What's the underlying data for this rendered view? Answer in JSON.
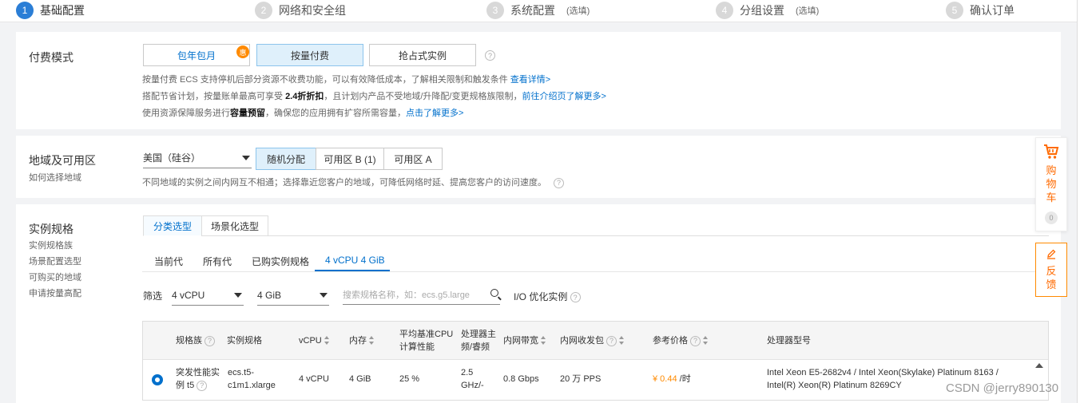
{
  "steps": [
    {
      "num": "1",
      "label": "基础配置",
      "optional": ""
    },
    {
      "num": "2",
      "label": "网络和安全组",
      "optional": ""
    },
    {
      "num": "3",
      "label": "系统配置",
      "optional": "(选填)"
    },
    {
      "num": "4",
      "label": "分组设置",
      "optional": "(选填)"
    },
    {
      "num": "5",
      "label": "确认订单",
      "optional": ""
    }
  ],
  "billing": {
    "title": "付费模式",
    "options": [
      "包年包月",
      "按量付费",
      "抢占式实例"
    ],
    "badge": "惠",
    "help": "?",
    "desc1": "按量付费 ECS 支持停机后部分资源不收费功能，可以有效降低成本，了解相关限制和触发条件 ",
    "desc1_link": "查看详情>",
    "desc2_a": "搭配节省计划，按量账单最高可享受 ",
    "desc2_bold": "2.4折折扣",
    "desc2_b": "，且计划内产品不受地域/升降配/变更规格族限制，",
    "desc2_link": "前往介绍页了解更多>",
    "desc3_a": "使用资源保障服务进行",
    "desc3_bold": "容量预留",
    "desc3_b": "，确保您的应用拥有扩容所需容量，",
    "desc3_link": "点击了解更多>"
  },
  "region": {
    "title": "地域及可用区",
    "link": "如何选择地域",
    "selected": "美国（硅谷）",
    "zones": [
      "随机分配",
      "可用区 B (1)",
      "可用区 A"
    ],
    "desc": "不同地域的实例之间内网互不相通；选择靠近您客户的地域，可降低网络时延、提高您客户的访问速度。",
    "help": "?"
  },
  "instance": {
    "title": "实例规格",
    "links": [
      "实例规格族",
      "场景配置选型",
      "可购买的地域",
      "申请按量高配"
    ],
    "tabs": [
      "分类选型",
      "场景化选型"
    ],
    "subtabs": [
      "当前代",
      "所有代",
      "已购实例规格",
      "4 vCPU 4 GiB"
    ],
    "filter_label": "筛选",
    "vcpu": "4 vCPU",
    "mem": "4 GiB",
    "search_placeholder": "搜索规格名称，如：ecs.g5.large",
    "io_label": "I/O 优化实例",
    "help": "?",
    "columns": {
      "family": "规格族",
      "spec": "实例规格",
      "vcpu": "vCPU",
      "mem": "内存",
      "cpu_perf_1": "平均基准CPU",
      "cpu_perf_2": "计算性能",
      "freq_1": "处理器主",
      "freq_2": "频/睿频",
      "bandwidth": "内网带宽",
      "pps": "内网收发包",
      "price": "参考价格",
      "cpu_model": "处理器型号"
    },
    "row": {
      "family_1": "突发性能实",
      "family_2": "例 t5",
      "spec_1": "ecs.t5-",
      "spec_2": "c1m1.xlarge",
      "vcpu": "4 vCPU",
      "mem": "4 GiB",
      "cpu_perf": "25 %",
      "freq_1": "2.5",
      "freq_2": "GHz/-",
      "bandwidth": "0.8 Gbps",
      "pps": "20 万 PPS",
      "price": "¥ 0.44",
      "price_unit": " /时",
      "cpu_model_1": "Intel Xeon E5-2682v4 / Intel Xeon(Skylake) Platinum 8163 /",
      "cpu_model_2": "Intel(R) Xeon(R) Platinum 8269CY"
    }
  },
  "floats": {
    "cart": [
      "购",
      "物",
      "车"
    ],
    "cart_count": "0",
    "feedback": [
      "反",
      "馈"
    ]
  },
  "watermark": "CSDN @jerry890130",
  "colors": {
    "accent": "#0070cc",
    "orange": "#ff8a00",
    "selected_bg": "#dff0fb"
  }
}
